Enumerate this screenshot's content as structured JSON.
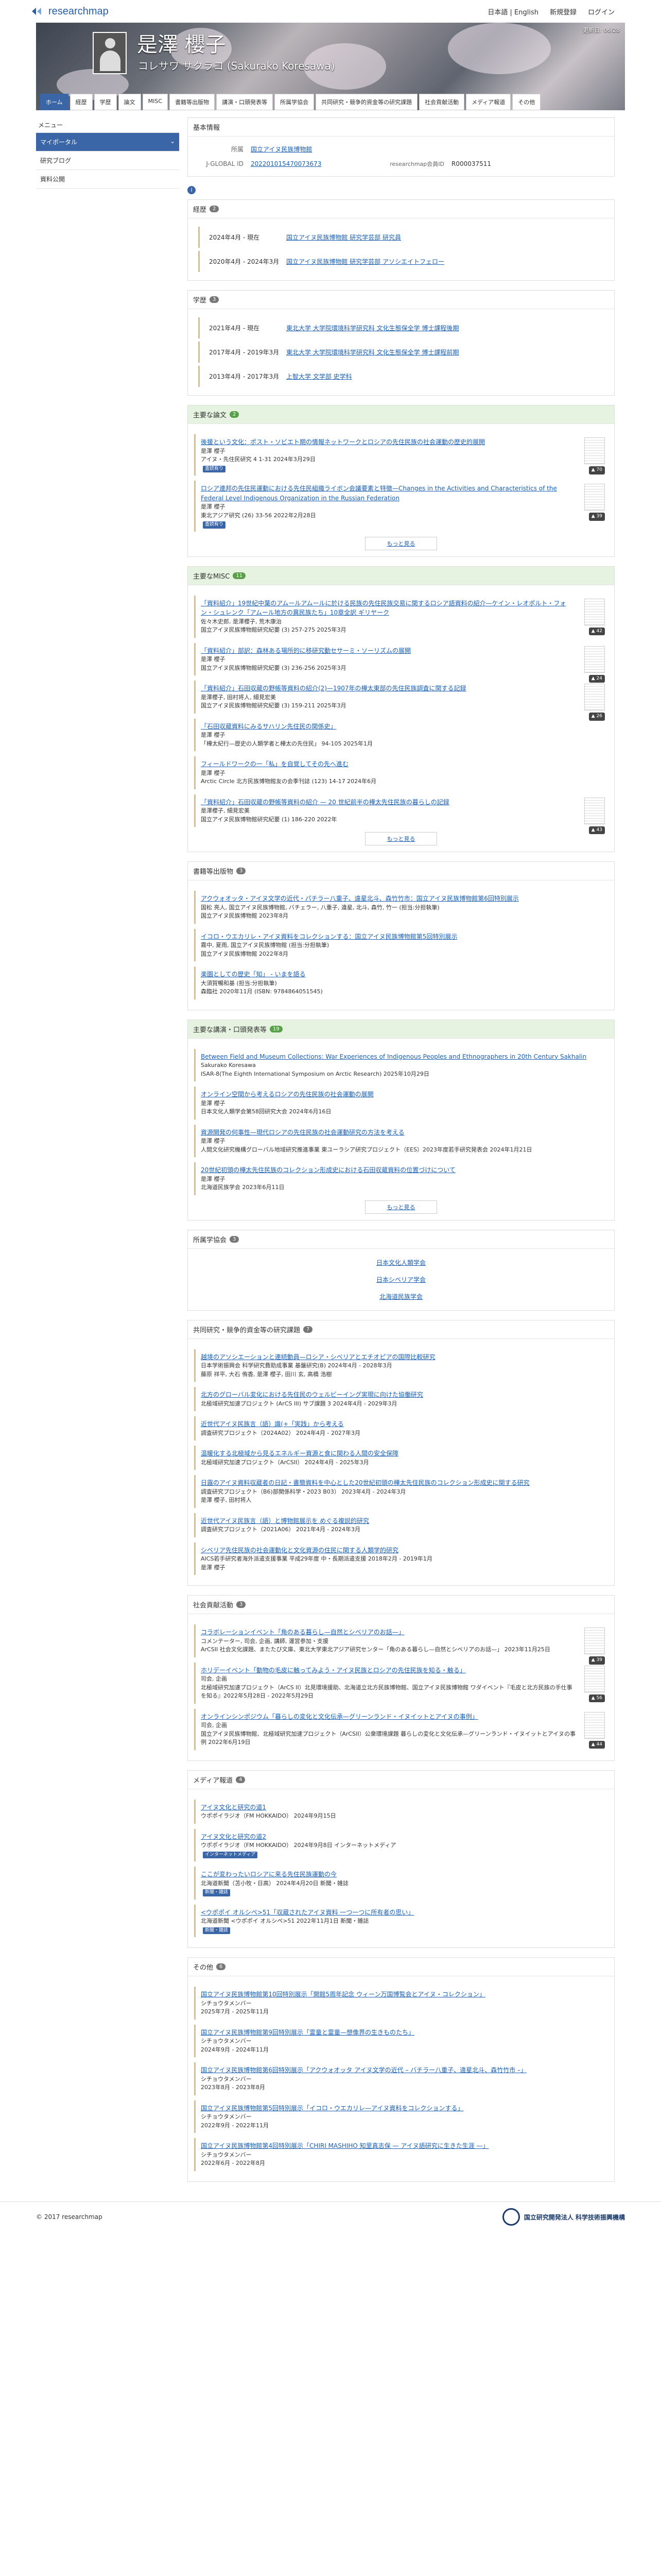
{
  "top": {
    "logo_text": "researchmap",
    "nav": [
      "日本語 | English",
      "新規登録",
      "ログイン"
    ]
  },
  "hero": {
    "name": "是澤 櫻子",
    "name_en": "コレサワ サクラコ (Sakurako Koresawa)",
    "updated_label": "更新日: 06/28"
  },
  "tabs": [
    "ホーム",
    "経歴",
    "学歴",
    "論文",
    "MISC",
    "書籍等出版物",
    "講演・口頭発表等",
    "所属学協会",
    "共同研究・競争的資金等の研究課題",
    "社会貢献活動",
    "メディア報道",
    "その他"
  ],
  "side": {
    "head": "メニュー",
    "items": [
      "マイポータル",
      "研究ブログ",
      "資料公開"
    ]
  },
  "basic": {
    "title": "基本情報",
    "affil_k": "所属",
    "affil_v": "国立アイヌ民族博物館",
    "jglobal_k": "J-GLOBAL ID",
    "jglobal_v": "202201015470073673",
    "rmid_k": "researchmap会員ID",
    "rmid_v": "R000037511"
  },
  "career": {
    "title": "経歴",
    "count": "2",
    "items": [
      {
        "d": "2024年4月 - 現在",
        "t": "国立アイヌ民族博物館 研究学芸部 研究員"
      },
      {
        "d": "2020年4月 - 2024年3月",
        "t": "国立アイヌ民族博物館 研究学芸部 アソシエイトフェロー"
      }
    ]
  },
  "edu": {
    "title": "学歴",
    "count": "3",
    "items": [
      {
        "d": "2021年4月 - 現在",
        "t": "東北大学 大学院環境科学研究科 文化生態保全学 博士課程後期"
      },
      {
        "d": "2017年4月 - 2019年3月",
        "t": "東北大学 大学院環境科学研究科 文化生態保全学 博士課程前期"
      },
      {
        "d": "2013年4月 - 2017年3月",
        "t": "上智大学 文学部 史学科"
      }
    ]
  },
  "papers": {
    "title": "主要な論文",
    "count": "2",
    "more": "もっと見る",
    "items": [
      {
        "t": "後援という文化：ポスト・ソビエト期の情報ネットワークとロシアの先住民族の社会運動の歴史的展開",
        "a": "是澤 櫻子",
        "s": "アイヌ・先住民研究 4 1-31 2024年3月29日",
        "tag": "査読有り",
        "badge": "▲ 70"
      },
      {
        "t": "ロシア連邦の先住民運動における先住民組織ライボン会議要素と特徴—Changes in the Activities and Characteristics of the Federal Level Indigenous Organization in the Russian Federation",
        "a": "是澤 櫻子",
        "s": "東北アジア研究 (26) 33-56 2022年2月28日",
        "tag": "査読有り",
        "badge": "▲ 39"
      }
    ]
  },
  "misc": {
    "title": "主要なMISC",
    "count": "11",
    "more": "もっと見る",
    "items": [
      {
        "t": "「資料紹介」19世紀中葉のアムールアムールに於ける民族の先住民族交易に関するロシア語資料の紹介—ケイン・レオポルト・フォン・シュレンク「アムール地方の異民族たち」10章全訳 ギリヤーク",
        "a": "佐々木史郎, 是澤櫻子, 荒木康治",
        "s": "国立アイヌ民族博物館研究紀要 (3) 257-275 2025年3月",
        "badge": "▲ 42"
      },
      {
        "t": "「資料紹介」部訳：森林ある場所的に移研究動セサーミ・ソーリズムの展開",
        "a": "是澤 櫻子",
        "s": "国立アイヌ民族博物館研究紀要 (3) 236-256 2025年3月",
        "badge": "▲ 24"
      },
      {
        "t": "「資料紹介」石田収蔵の野帳等資料の紹介(2)—1907年の樺太東部の先住民族調査に関する記録",
        "a": "是澤櫻子, 田村将人, 細見宏美",
        "s": "国立アイヌ民族博物館研究紀要 (3) 159-211 2025年3月",
        "badge": "▲ 26"
      },
      {
        "t": "「石田収蔵資料にみるサハリン先住民の関係史」",
        "a": "是澤 櫻子",
        "s": "「樺太紀行—歴史の人類学者と樺太の先住民」 94-105 2025年1月",
        "badge": ""
      },
      {
        "t": "フィールドワークの一「私」を自覚してその先へ進む",
        "a": "是澤 櫻子",
        "s": "Arctic Circle 北方民族博物館友の会季刊誌 (123) 14-17 2024年6月",
        "badge": ""
      },
      {
        "t": "「資料紹介」石田収蔵の野帳等資料の紹介 — 20 世紀前半の樺太先住民族の暮らしの記録",
        "a": "是澤櫻子, 細見宏美",
        "s": "国立アイヌ民族博物館研究紀要 (1) 186-220 2022年",
        "badge": "▲ 43"
      }
    ]
  },
  "books": {
    "title": "書籍等出版物",
    "count": "3",
    "items": [
      {
        "t": "アクウォオッタ・アイヌ文学の近代・パチラー八重子、遠星北斗、森竹竹市：国立アイヌ民族博物館第6回特別展示",
        "a": "国松 亮人, 国立アイヌ民族博物館, バチェラー, 八重子, 違星, 北斗, 森竹, 竹一 (担当:分担執筆)",
        "s": "国立アイヌ民族博物館 2023年8月"
      },
      {
        "t": "イコロ・ウエカリレ・アイヌ資料をコレクションする：国立アイヌ民族博物館第5回特別展示",
        "a": "霧中, 夏雨, 国立アイヌ民族博物館 (担当:分担執筆)",
        "s": "国立アイヌ民族博物館 2022年8月"
      },
      {
        "t": "楽園としての歴史「知」 - いまを語る",
        "a": "大須賀暢和基 (担当:分担執筆)",
        "s": "森臨社 2020年11月 (ISBN: 9784864051545)"
      }
    ]
  },
  "talks": {
    "title": "主要な講演・口頭発表等",
    "count": "19",
    "more": "もっと見る",
    "items": [
      {
        "t": "Between Field and Museum Collections: War Experiences of Indigenous Peoples and Ethnographers in 20th Century Sakhalin",
        "a": "Sakurako Koresawa",
        "s": "ISAR-8(The Eighth International Symposium on Arctic Research) 2025年10月29日"
      },
      {
        "t": "オンライン空間から考えるロシアの先住民族の社会運動の展開",
        "a": "是澤 櫻子",
        "s": "日本文化人類学会第58回研究大会 2024年6月16日"
      },
      {
        "t": "資源開発の何事性—現代ロシアの先住民族の社会運動研究の方法を考える",
        "a": "是澤 櫻子",
        "s": "人間文化研究機構グローバル地域研究推進事業 東ユーラシア研究プロジェクト（EES）2023年度若手研究発表会 2024年1月21日"
      },
      {
        "t": "20世紀初頭の樺太先住民族のコレクション形成史における石田収蔵資料の位置づけについて",
        "a": "是澤 櫻子",
        "s": "北海道民族学会 2023年6月11日"
      }
    ]
  },
  "societies": {
    "title": "所属学協会",
    "count": "3",
    "items": [
      "日本文化人類学会",
      "日本シベリア学会",
      "北海道民族学会"
    ]
  },
  "projects": {
    "title": "共同研究・競争的資金等の研究課題",
    "count": "7",
    "items": [
      {
        "t": "越境のアソシエーションと連続動員—ロシア・シベリアとエチオピアの国際比較研究",
        "a": "日本学術振興会 科学研究費助成事業 基盤研究(B) 2024年4月 - 2028年3月",
        "s": "藤原 祥平, 大石 侑香, 是澤 櫻子, 田川 玄, 高橋 浩樹"
      },
      {
        "t": "北方のグローバル変化における先住民のウェルビーイング実現に向けた協働研究",
        "a": "北極域研究加速プロジェクト (ArCS III) サブ課題 3 2024年4月 - 2029年3月",
        "s": ""
      },
      {
        "t": "近世代アイヌ民族言（語）識(+「実践」から考える",
        "a": "調査研究プロジェクト（2024A02） 2024年4月 - 2027年3月",
        "s": ""
      },
      {
        "t": "温暖化する北極域から見るエネルギー資源と食に関わる人間の安全保障",
        "a": "北極域研究加速プロジェクト（ArCSII） 2024年4月 - 2025年3月",
        "s": ""
      },
      {
        "t": "日露のアイヌ資料収蔵者の日記・書簡資料を中心とした20世紀初頭の樺太先住民族のコレクション形成史に関する研究",
        "a": "調査研究プロジェクト（B6)部関係科学・2023 B03） 2023年4月 - 2024年3月",
        "s": "是澤 櫻子, 田村将人"
      },
      {
        "t": "近世代アイヌ民族言（語）と博物館展示を めぐる複説的研究",
        "a": "調査研究プロジェクト（2021A06） 2021年4月 - 2024年3月",
        "s": ""
      },
      {
        "t": "シベリア先住民族の社会運動化と文化資源の住民に関する人類学的研究",
        "a": "AICS若手研究者海外派遣支援事業 平成29年度 中・長期派遣支援 2018年2月 - 2019年1月",
        "s": "是澤 櫻子"
      }
    ]
  },
  "social": {
    "title": "社会貢献活動",
    "count": "3",
    "items": [
      {
        "t": "コラボレーションイベント「角のある暮らし—自然とシベリアのお話—」",
        "a": "コメンテーター, 司会, 企画, 講師, 運営参加・支援",
        "s": "ArCSII 社会文化課題、またたび文庫、東北大学東北アジア研究センター「角のある暮らし—自然とシベリアのお話—」 2023年11月25日",
        "badge": "▲ 39"
      },
      {
        "t": "ホリデーイベント「動物の毛皮に触ってみよう・アイヌ民族とロシアの先住民族を知る・触る」",
        "a": "司会, 企画",
        "s": "北極域研究加速プロジェクト（ArCS II）北見環境援助、北海道立北方民族博物館、国立アイヌ民族博物館 ワダイベント『毛皮と北方民族の手仕事を知る』2022年5月28日 - 2022年5月29日",
        "badge": "▲ 56"
      },
      {
        "t": "オンラインシンポジウム「暮らしの変化と文化伝承—グリーンランド・イヌイットとアイヌの事例」",
        "a": "司会, 企画",
        "s": "国立アイヌ民族博物館、北極域研究加速プロジェクト（ArCSII）公衆環境課題 暮らしの変化と文化伝承—グリーンランド・イヌイットとアイヌの事例 2022年6月19日",
        "badge": "▲ 44"
      }
    ]
  },
  "media": {
    "title": "メディア報道",
    "count": "4",
    "items": [
      {
        "t": "アイヌ文化と研究の道1",
        "s": "ウポポイラジオ（FM HOKKAIDO） 2024年9月15日"
      },
      {
        "t": "アイヌ文化と研究の道2",
        "s": "ウポポイラジオ（FM HOKKAIDO） 2024年9月8日 インターネットメディア",
        "tag": "インターネットメディア"
      },
      {
        "t": "ここが変わったいロシアに来る先住民族運動の今",
        "s": "北海道新聞（苫小牧・日高） 2024年4月20日 新聞・雑誌",
        "tag": "新聞・雑誌"
      },
      {
        "t": "<ウポポイ オルシペ>51「収蔵されたアイヌ資料 一つ一つに所有者の思い」",
        "s": "北海道新聞 <ウポポイ オルシペ>51 2022年11月1日 新聞・雑誌",
        "tag": "新聞・雑誌"
      }
    ]
  },
  "other": {
    "title": "その他",
    "count": "6",
    "items": [
      {
        "t": "国立アイヌ民族博物館第10回特別展示「開館5周年記念 ウィーン万国博覧会とアイヌ・コレクション」",
        "s": "2025年7月 - 2025年11月",
        "a": "シチョウタメンバー"
      },
      {
        "t": "国立アイヌ民族博物館第9回特別展示「霊童と霊童—想像界の生きものたち」",
        "s": "2024年9月 - 2024年11月",
        "a": "シチョウタメンバー"
      },
      {
        "t": "国立アイヌ民族博物館第6回特別展示「アクウォオッタ アイヌ文学の近代 – バチラー八重子、違星北斗、森竹竹市 –」",
        "s": "2023年8月 - 2023年8月",
        "a": "シチョウタメンバー"
      },
      {
        "t": "国立アイヌ民族博物館第5回特別展示「イコロ・ウエカリレ—アイヌ資料をコレクションする」",
        "s": "2022年9月 - 2022年11月",
        "a": "シチョウタメンバー"
      },
      {
        "t": "国立アイヌ民族博物館第4回特別展示「CHIRI MASHIHO 知里真志保 — アイヌ語研究に生きた生涯 —」",
        "s": "2022年6月 - 2022年8月",
        "a": "シチョウタメンバー"
      }
    ]
  },
  "footer": {
    "copy": "© 2017 researchmap",
    "jst": "国立研究開発法人 科学技術振興機構"
  }
}
